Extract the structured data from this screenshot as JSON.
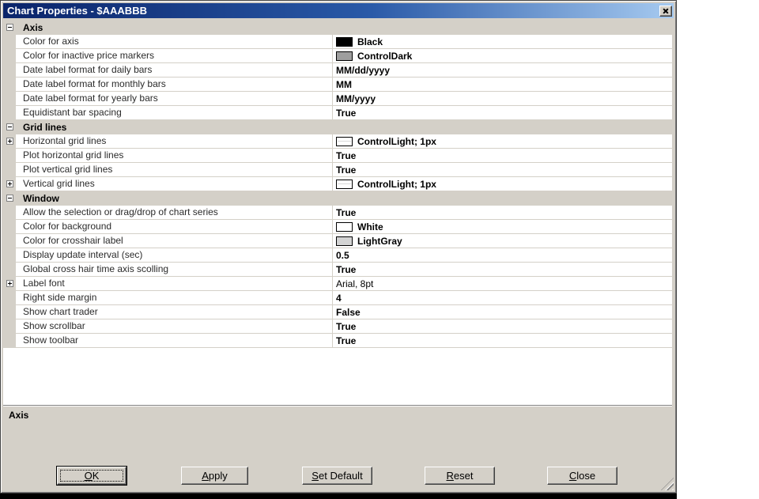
{
  "window": {
    "title": "Chart Properties - $AAABBB"
  },
  "colors": {
    "titlebar_left": "#0a246a",
    "titlebar_right": "#a6caf0",
    "dialog_face": "#d4d0c8",
    "row_separator": "#d4d0c8",
    "swatch_black": "#000000",
    "swatch_controldark": "#9e9e9e",
    "swatch_white": "#ffffff",
    "swatch_lightgray": "#d3d3d3",
    "swatch_controllight_line": "#d9d9d9"
  },
  "property_grid": {
    "sections": [
      {
        "label": "Axis",
        "expanded": true,
        "rows": [
          {
            "name": "Color for axis",
            "value": "Black",
            "swatch": "#000000"
          },
          {
            "name": "Color for inactive price markers",
            "value": "ControlDark",
            "swatch": "#9e9e9e"
          },
          {
            "name": "Date label format for daily bars",
            "value": "MM/dd/yyyy"
          },
          {
            "name": "Date label format for monthly bars",
            "value": "MM"
          },
          {
            "name": "Date label format for yearly bars",
            "value": "MM/yyyy"
          },
          {
            "name": "Equidistant bar spacing",
            "value": "True"
          }
        ]
      },
      {
        "label": "Grid lines",
        "expanded": true,
        "rows": [
          {
            "name": "Horizontal grid lines",
            "value": "ControlLight; 1px",
            "swatch_type": "line",
            "expandable": true
          },
          {
            "name": "Plot horizontal grid lines",
            "value": "True"
          },
          {
            "name": "Plot vertical grid lines",
            "value": "True"
          },
          {
            "name": "Vertical grid lines",
            "value": "ControlLight; 1px",
            "swatch_type": "line",
            "expandable": true
          }
        ]
      },
      {
        "label": "Window",
        "expanded": true,
        "rows": [
          {
            "name": "Allow the selection or drag/drop of chart series",
            "value": "True"
          },
          {
            "name": "Color for background",
            "value": "White",
            "swatch": "#ffffff"
          },
          {
            "name": "Color for crosshair label",
            "value": "LightGray",
            "swatch": "#d3d3d3"
          },
          {
            "name": "Display update interval (sec)",
            "value": "0.5"
          },
          {
            "name": "Global cross hair time axis scolling",
            "value": "True"
          },
          {
            "name": "Label font",
            "value": "Arial, 8pt",
            "expandable": true,
            "bold": false
          },
          {
            "name": "Right side margin",
            "value": "4"
          },
          {
            "name": "Show chart trader",
            "value": "False"
          },
          {
            "name": "Show scrollbar",
            "value": "True"
          },
          {
            "name": "Show toolbar",
            "value": "True"
          }
        ]
      }
    ]
  },
  "description": {
    "title": "Axis"
  },
  "buttons": [
    {
      "label": "OK",
      "mnemonic_index": 0,
      "default": true
    },
    {
      "label": "Apply",
      "mnemonic_index": 0
    },
    {
      "label": "Set Default",
      "mnemonic_index": 0
    },
    {
      "label": "Reset",
      "mnemonic_index": 0
    },
    {
      "label": "Close",
      "mnemonic_index": 0
    }
  ]
}
